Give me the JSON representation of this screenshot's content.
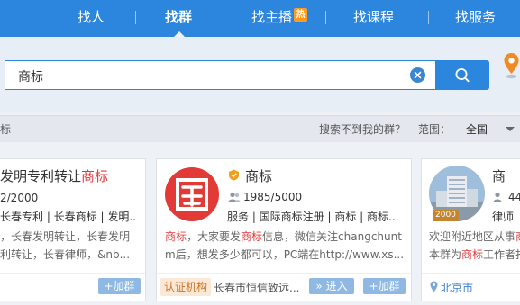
{
  "nav": {
    "items": [
      "找人",
      "找群",
      "找主播",
      "找课程",
      "找服务"
    ],
    "hot_badge": "热",
    "active": "找群"
  },
  "search": {
    "value": "商标"
  },
  "filter": {
    "left_partial": "标",
    "not_found": "搜索不到我的群？",
    "range_label": "范围：",
    "range_value": "全国"
  },
  "cards": [
    {
      "title_prefix": "发明专利转让",
      "title_hl": "商标",
      "count": "2/2000",
      "tags": "长春专利 | 长春商标 | 发明...",
      "desc_line1": "，长春发明转让，长春发明",
      "desc_line2": "利转让，长春律师，&nb...",
      "add_label": "+加群"
    },
    {
      "title": "商标",
      "count": "1985/5000",
      "tags": "服务 | 国际商标注册 | 商标 | 商标...",
      "desc_hl1": "商标",
      "desc_mid1": "，大家要发",
      "desc_hl2": "商标",
      "desc_rest1": "信息，微信关注changchunt",
      "desc_line2": "m后，想发多少都可以，PC端在http://www.xs...",
      "cert": "认证机构",
      "location": "长春市恒信致远...",
      "enter_label": "» 进入",
      "add_label": "+加群"
    },
    {
      "title_partial": "商",
      "count_partial": "44",
      "tag_partial": "律师",
      "desc_line1": "欢迎附近地区从事",
      "desc_line1_hl": "商",
      "desc_line2_pre": "本群为",
      "desc_line2_hl": "商标",
      "desc_line2_post": "工作者打",
      "year_badge": "2000",
      "location": "北京市"
    }
  ]
}
